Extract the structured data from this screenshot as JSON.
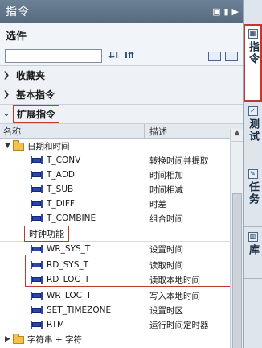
{
  "titlebar": {
    "title": "指令",
    "icons": [
      "window-icon",
      "minimize-icon",
      "expand-arrow-icon"
    ]
  },
  "options_label": "选件",
  "search": {
    "value": "",
    "toolbar_icons": [
      "filter-add-icon",
      "filter-remove-icon"
    ]
  },
  "sections": {
    "favorites": "收藏夹",
    "basic": "基本指令",
    "extended": "扩展指令"
  },
  "columns": {
    "name": "名称",
    "description": "描述"
  },
  "folder_datetime": "日期和时间",
  "datetime_items": [
    {
      "name": "T_CONV",
      "desc": "转换时间并提取"
    },
    {
      "name": "T_ADD",
      "desc": "时间相加"
    },
    {
      "name": "T_SUB",
      "desc": "时间相减"
    },
    {
      "name": "T_DIFF",
      "desc": "时差"
    },
    {
      "name": "T_COMBINE",
      "desc": "组合时间"
    }
  ],
  "clock_functions_label": "时钟功能",
  "clock_items": [
    {
      "name": "WR_SYS_T",
      "desc": "设置时间"
    },
    {
      "name": "RD_SYS_T",
      "desc": "读取时间"
    },
    {
      "name": "RD_LOC_T",
      "desc": "读取本地时间"
    },
    {
      "name": "WR_LOC_T",
      "desc": "写入本地时间"
    },
    {
      "name": "SET_TIMEZONE",
      "desc": "设置时区"
    },
    {
      "name": "RTM",
      "desc": "运行时间定时器"
    }
  ],
  "folder_strings": "字符串 + 字符",
  "side_tabs": [
    "指令",
    "测试",
    "任务",
    "库"
  ]
}
